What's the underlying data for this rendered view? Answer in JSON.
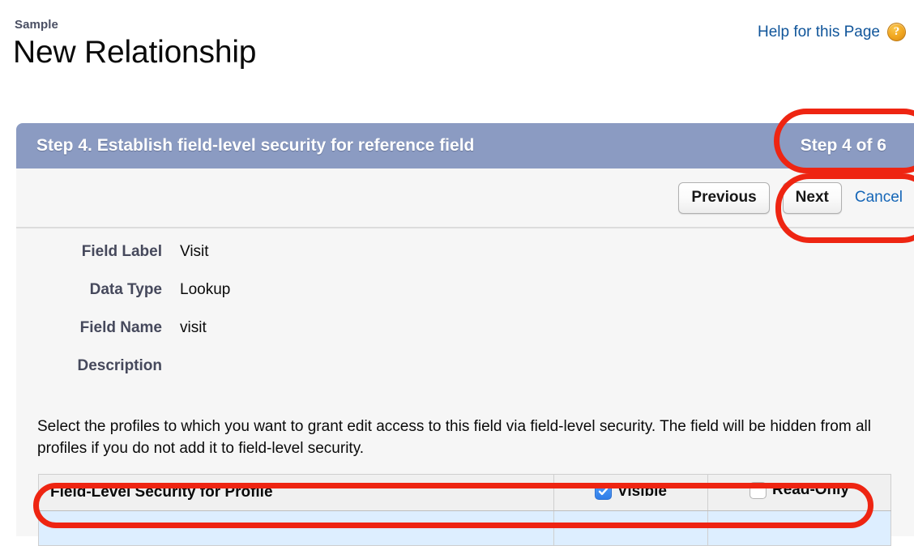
{
  "header": {
    "breadcrumb": "Sample",
    "title": "New Relationship",
    "help_link": "Help for this Page",
    "help_icon": "question-mark-icon",
    "help_icon_glyph": "?",
    "help_link_color": "#10559a",
    "help_icon_color": "#f0a51e"
  },
  "wizard": {
    "step_title": "Step 4. Establish field-level security for reference field",
    "step_counter": "Step 4 of 6",
    "bar_color": "#8b9bc2",
    "buttons": {
      "previous": "Previous",
      "next": "Next",
      "cancel": "Cancel"
    }
  },
  "details": [
    {
      "label": "Field Label",
      "value": "Visit"
    },
    {
      "label": "Data Type",
      "value": "Lookup"
    },
    {
      "label": "Field Name",
      "value": "visit"
    },
    {
      "label": "Description",
      "value": ""
    }
  ],
  "instructions": "Select the profiles to which you want to grant edit access to this field via field-level security. The field will be hidden from all profiles if you do not add it to field-level security.",
  "security_table": {
    "columns": [
      "Field-Level Security for Profile",
      "Visible",
      "Read-Only"
    ],
    "visible_checked": true,
    "read_only_checked": false,
    "checkbox_checked_color": "#3c8cf5"
  },
  "annotations": {
    "color": "#ee2512",
    "shapes": [
      {
        "name": "step-counter-highlight",
        "target": "Step 4 of 6"
      },
      {
        "name": "nav-buttons-highlight",
        "target": "Next / Cancel"
      },
      {
        "name": "table-header-highlight",
        "target": "Field-Level Security for Profile row"
      }
    ]
  }
}
